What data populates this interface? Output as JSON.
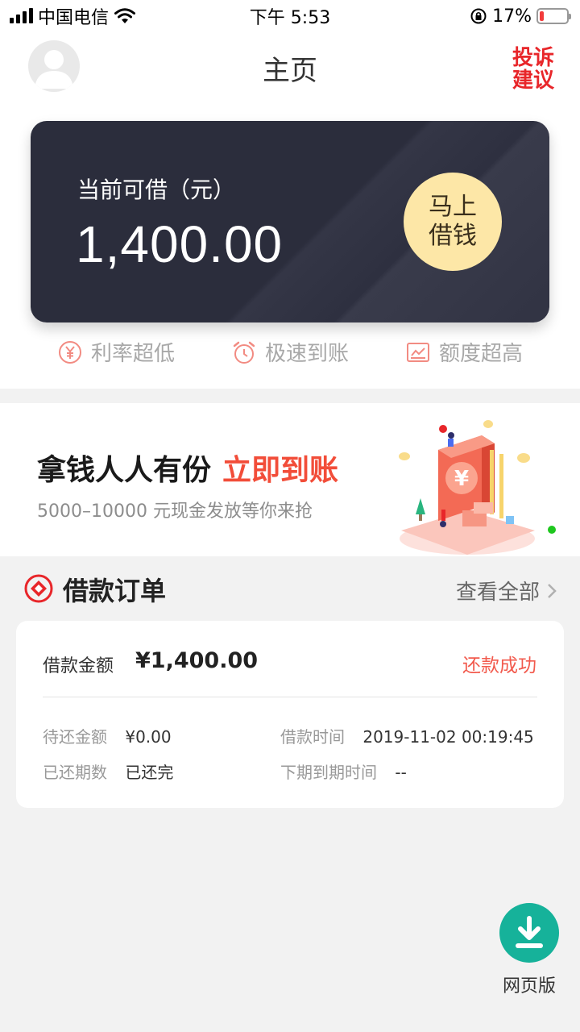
{
  "status_bar": {
    "carrier": "中国电信",
    "time": "下午 5:53",
    "battery": "17%",
    "battery_level": 0.17
  },
  "header": {
    "title": "主页",
    "complaint_label": "投诉建议"
  },
  "loan_card": {
    "label": "当前可借（元）",
    "amount": "1,400.00",
    "button_label": "马上借钱"
  },
  "features": [
    {
      "label": "利率超低",
      "icon": "yen-circle-icon"
    },
    {
      "label": "极速到账",
      "icon": "alarm-clock-icon"
    },
    {
      "label": "额度超高",
      "icon": "chart-icon"
    }
  ],
  "banner": {
    "headline": "拿钱人人有份",
    "highlight": "立即到账",
    "subtitle": "5000–10000 元现金发放等你来抢",
    "highlight_color": "#f24d39"
  },
  "orders": {
    "title": "借款订单",
    "view_all": "查看全部",
    "card": {
      "amount_label": "借款金额",
      "amount": "¥1,400.00",
      "status": "还款成功",
      "rows": [
        {
          "key": "待还金额",
          "value": "¥0.00"
        },
        {
          "key": "借款时间",
          "value": "2019-11-02 00:19:45"
        },
        {
          "key": "已还期数",
          "value": "已还完"
        },
        {
          "key": "下期到期时间",
          "value": "--"
        }
      ]
    }
  },
  "fab": {
    "label": "网页版",
    "color": "#16b29a"
  },
  "colors": {
    "accent_red": "#e8262a",
    "card_bg": "#2b2d3c",
    "button_gold": "#fde7a7"
  }
}
